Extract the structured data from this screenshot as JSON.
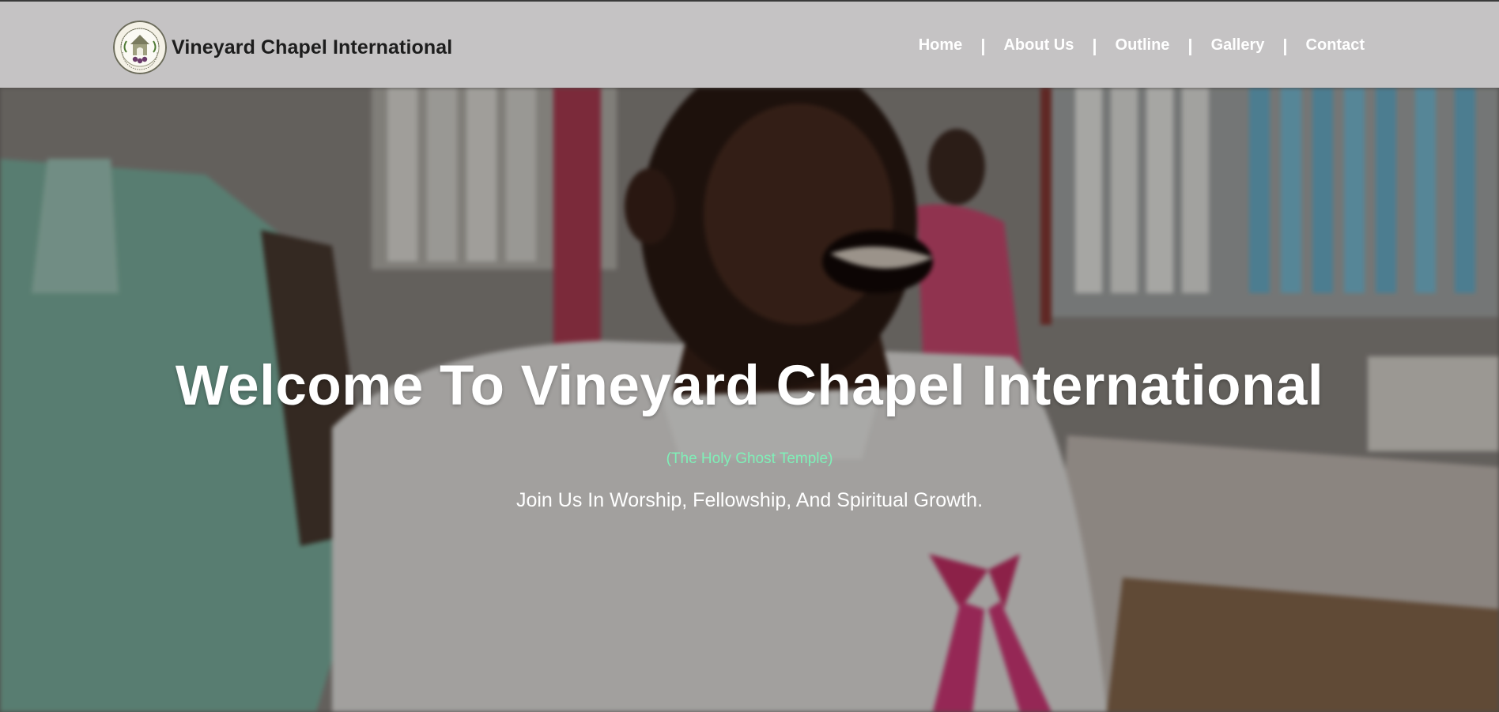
{
  "header": {
    "brand_name": "Vineyard Chapel International",
    "logo_icon": "church-seal-logo",
    "logo_text": "VINEYARD CHAPEL INTERNATIONAL"
  },
  "nav": {
    "items": [
      {
        "label": "Home"
      },
      {
        "label": "About Us"
      },
      {
        "label": "Outline"
      },
      {
        "label": "Gallery"
      },
      {
        "label": "Contact"
      }
    ],
    "separator": "|"
  },
  "hero": {
    "title": "Welcome To Vineyard Chapel International",
    "subtitle": "(The Holy Ghost Temple)",
    "tagline": "Join Us In Worship, Fellowship, And Spiritual Growth."
  },
  "colors": {
    "navbar_bg": "#c5c3c4",
    "brand_text": "#1d1d1d",
    "nav_text": "#ffffff",
    "subtitle_accent": "#7ff0b8"
  }
}
